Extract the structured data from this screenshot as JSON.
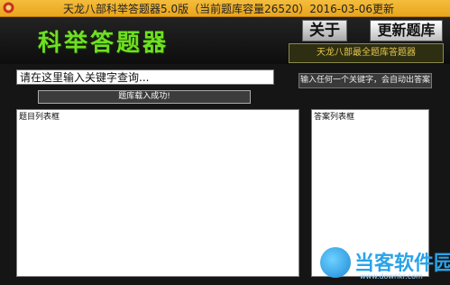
{
  "window": {
    "title": "天龙八部科举答题器5.0版（当前题库容量26520）2016-03-06更新"
  },
  "header": {
    "logo_text": "科举答题器",
    "about_label": "关于",
    "update_label": "更新题库",
    "banner_text": "天龙八部最全题库答题器"
  },
  "search": {
    "value": "请在这里输入关键字查询...",
    "hint": "输入任何一个关键字，会自动出答案"
  },
  "status": {
    "message": "题库载入成功!"
  },
  "panels": {
    "questions_label": "题目列表框",
    "answers_label": "答案列表框"
  },
  "watermark": {
    "text": "当客软件园",
    "url": "www.downkr.com"
  },
  "colors": {
    "title_bar": "#f4bd3c",
    "logo_green": "#6ee021",
    "banner_text": "#e3c74e",
    "background": "#151515"
  }
}
